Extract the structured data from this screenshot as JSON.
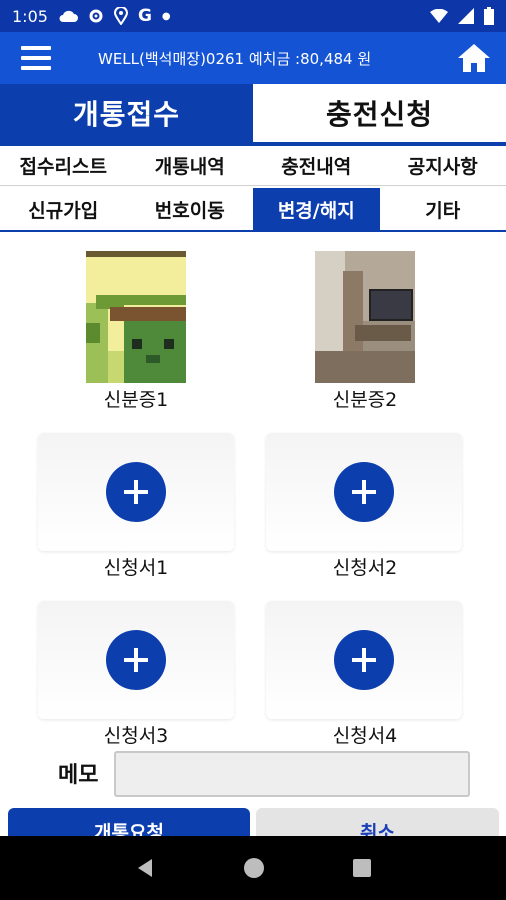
{
  "status": {
    "time": "1:05"
  },
  "header": {
    "title": "WELL(백석매장)0261 예치금 :80,484 원"
  },
  "main_tabs": [
    {
      "label": "개통접수",
      "active": true
    },
    {
      "label": "충전신청",
      "active": false
    }
  ],
  "sub_tabs": [
    "접수리스트",
    "개통내역",
    "충전내역",
    "공지사항"
  ],
  "category_tabs": [
    {
      "label": "신규가입",
      "active": false
    },
    {
      "label": "번호이동",
      "active": false
    },
    {
      "label": "변경/해지",
      "active": true
    },
    {
      "label": "기타",
      "active": false
    }
  ],
  "documents": {
    "id1_label": "신분증1",
    "id2_label": "신분증2",
    "form1_label": "신청서1",
    "form2_label": "신청서2",
    "form3_label": "신청서3",
    "form4_label": "신청서4"
  },
  "memo": {
    "label": "메모",
    "value": ""
  },
  "actions": {
    "submit_label": "개통요청",
    "cancel_label": "취소"
  },
  "colors": {
    "primary": "#0d3eae",
    "appbar": "#1453d4",
    "statusbar": "#0d36a8"
  }
}
